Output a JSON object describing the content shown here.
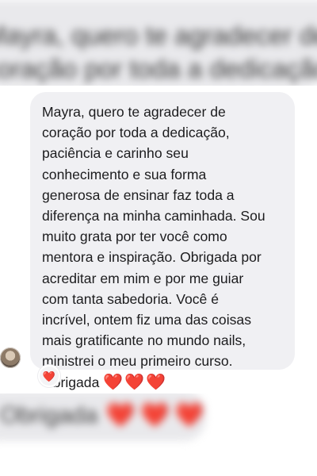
{
  "background": {
    "top_lines": [
      "Mayra, quero te agradecer de",
      "coração por toda a dedicação,"
    ],
    "bottom_text": "Obrigada",
    "bottom_hearts": "❤️❤️❤️"
  },
  "message": {
    "lines": [
      "Mayra, quero te agradecer de",
      "coração por toda a dedicação,",
      "paciência e carinho seu",
      "conhecimento e sua forma",
      "generosa de ensinar faz toda a",
      "diferença na minha caminhada. Sou",
      "muito grata por ter você como",
      "mentora e inspiração. Obrigada por",
      "acreditar em mim e por me guiar",
      "com tanta sabedoria. Você é",
      "incrível, ontem fiz uma das coisas",
      "mais gratificante no mundo nails,",
      "ministrei o meu primeiro curso."
    ],
    "last_line_text": "Obrigada",
    "last_line_hearts": "❤️❤️❤️"
  },
  "reaction": {
    "emoji": "❤️"
  },
  "colors": {
    "bubble": "#f0f0f3",
    "text": "#1c1c1e",
    "heart": "#e0253b"
  }
}
